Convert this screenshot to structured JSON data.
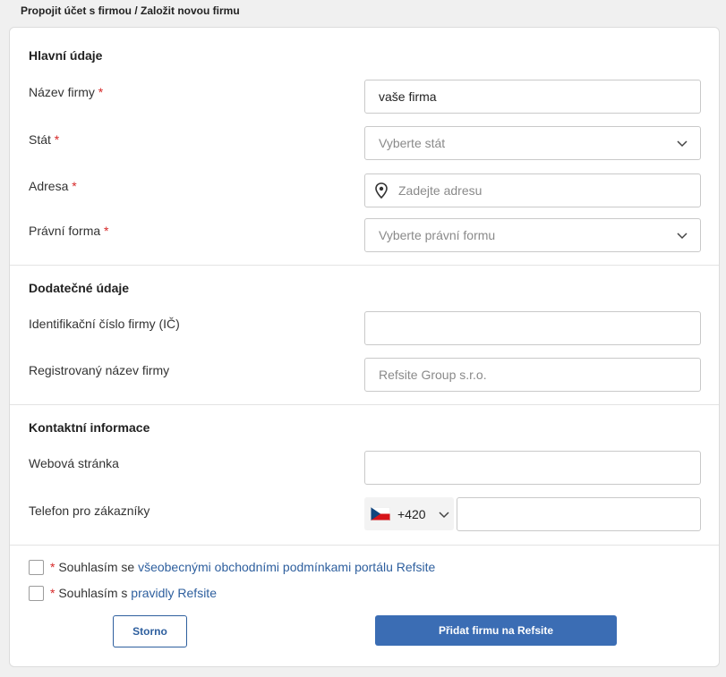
{
  "breadcrumb": "Propojit účet s firmou / Založit novou firmu",
  "sections": {
    "main": "Hlavní údaje",
    "additional": "Dodatečné údaje",
    "contact": "Kontaktní informace"
  },
  "fields": {
    "company_name": {
      "label": "Název firmy",
      "value": "vaše firma"
    },
    "state": {
      "label": "Stát",
      "placeholder": "Vyberte stát"
    },
    "address": {
      "label": "Adresa",
      "placeholder": "Zadejte adresu"
    },
    "legal_form": {
      "label": "Právní forma",
      "placeholder": "Vyberte právní formu"
    },
    "ico": {
      "label": "Identifikační číslo firmy (IČ)",
      "value": ""
    },
    "registered_name": {
      "label": "Registrovaný název firmy",
      "placeholder": "Refsite Group s.r.o."
    },
    "website": {
      "label": "Webová stránka",
      "value": ""
    },
    "phone": {
      "label": "Telefon pro zákazníky",
      "country_code": "+420",
      "value": ""
    }
  },
  "required_mark": "*",
  "consents": {
    "terms_prefix": "Souhlasím se ",
    "terms_link": "všeobecnými obchodními podmínkami portálu Refsite",
    "rules_prefix": "Souhlasím s ",
    "rules_link": "pravidly Refsite"
  },
  "buttons": {
    "cancel": "Storno",
    "submit": "Přidat firmu na Refsite"
  },
  "colors": {
    "accent": "#3b6db4",
    "link": "#2e5f9e",
    "required": "#d62828"
  },
  "icons": {
    "location": "location-pin-icon",
    "chevron": "chevron-down-icon",
    "flag": "czech-flag-icon"
  }
}
